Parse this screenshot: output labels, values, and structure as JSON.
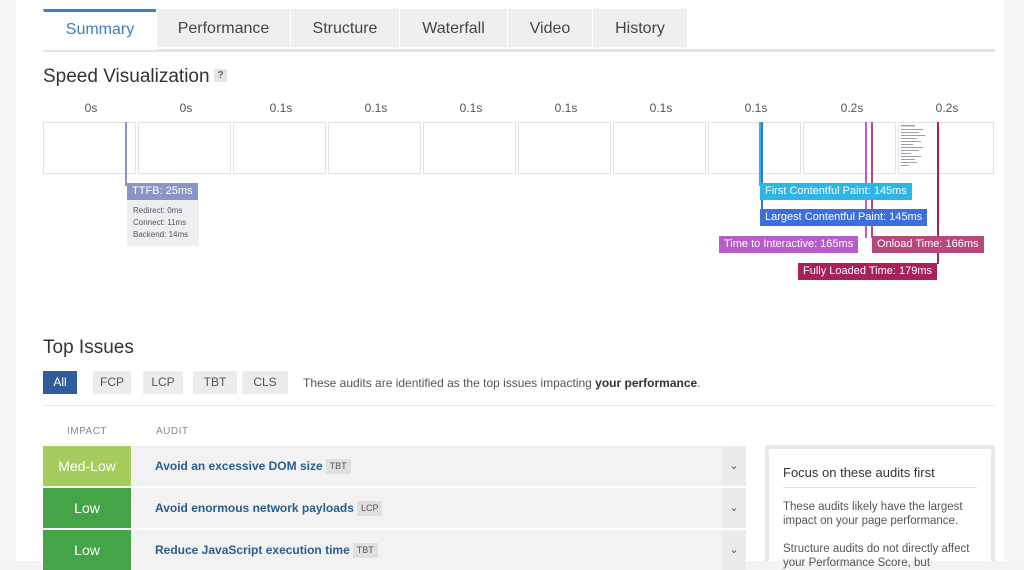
{
  "tabs": [
    "Summary",
    "Performance",
    "Structure",
    "Waterfall",
    "Video",
    "History"
  ],
  "speed": {
    "title": "Speed Visualization",
    "help": "?",
    "time_labels": [
      "0s",
      "0s",
      "0.1s",
      "0.1s",
      "0.1s",
      "0.1s",
      "0.1s",
      "0.1s",
      "0.2s",
      "0.2s"
    ],
    "ttfb": {
      "label": "TTFB: 25ms",
      "redirect": "Redirect: 0ms",
      "connect": "Connect: 11ms",
      "backend": "Backend: 14ms",
      "color": "#8a94c6"
    },
    "markers": {
      "fcp": {
        "label": "First Contentful Paint: 145ms",
        "color": "#2cb6e8"
      },
      "lcp": {
        "label": "Largest Contentful Paint: 145ms",
        "color": "#3a6fdc"
      },
      "tti": {
        "label": "Time to Interactive: 165ms",
        "color": "#b65dc9"
      },
      "onload": {
        "label": "Onload Time: 166ms",
        "color": "#b54a7a"
      },
      "fully_loaded": {
        "label": "Fully Loaded Time: 179ms",
        "color": "#a8215d"
      }
    }
  },
  "top_issues": {
    "title": "Top Issues",
    "filters": [
      "All",
      "FCP",
      "LCP",
      "TBT",
      "CLS"
    ],
    "intro_prefix": "These audits are identified as the top issues impacting ",
    "intro_bold": "your performance",
    "intro_suffix": ".",
    "columns": {
      "impact": "IMPACT",
      "audit": "AUDIT"
    },
    "rows": [
      {
        "impact": "Med-Low",
        "impact_color": "#a6cc5e",
        "title": "Avoid an excessive DOM size",
        "metric": "TBT"
      },
      {
        "impact": "Low",
        "impact_color": "#44a447",
        "title": "Avoid enormous network payloads",
        "metric": "LCP"
      },
      {
        "impact": "Low",
        "impact_color": "#44a447",
        "title": "Reduce JavaScript execution time",
        "metric": "TBT"
      }
    ],
    "expand_icon": "⌄"
  },
  "sidebar": {
    "title": "Focus on these audits first",
    "p1": "These audits likely have the largest impact on your page performance.",
    "p2": "Structure audits do not directly affect your Performance Score, but"
  }
}
